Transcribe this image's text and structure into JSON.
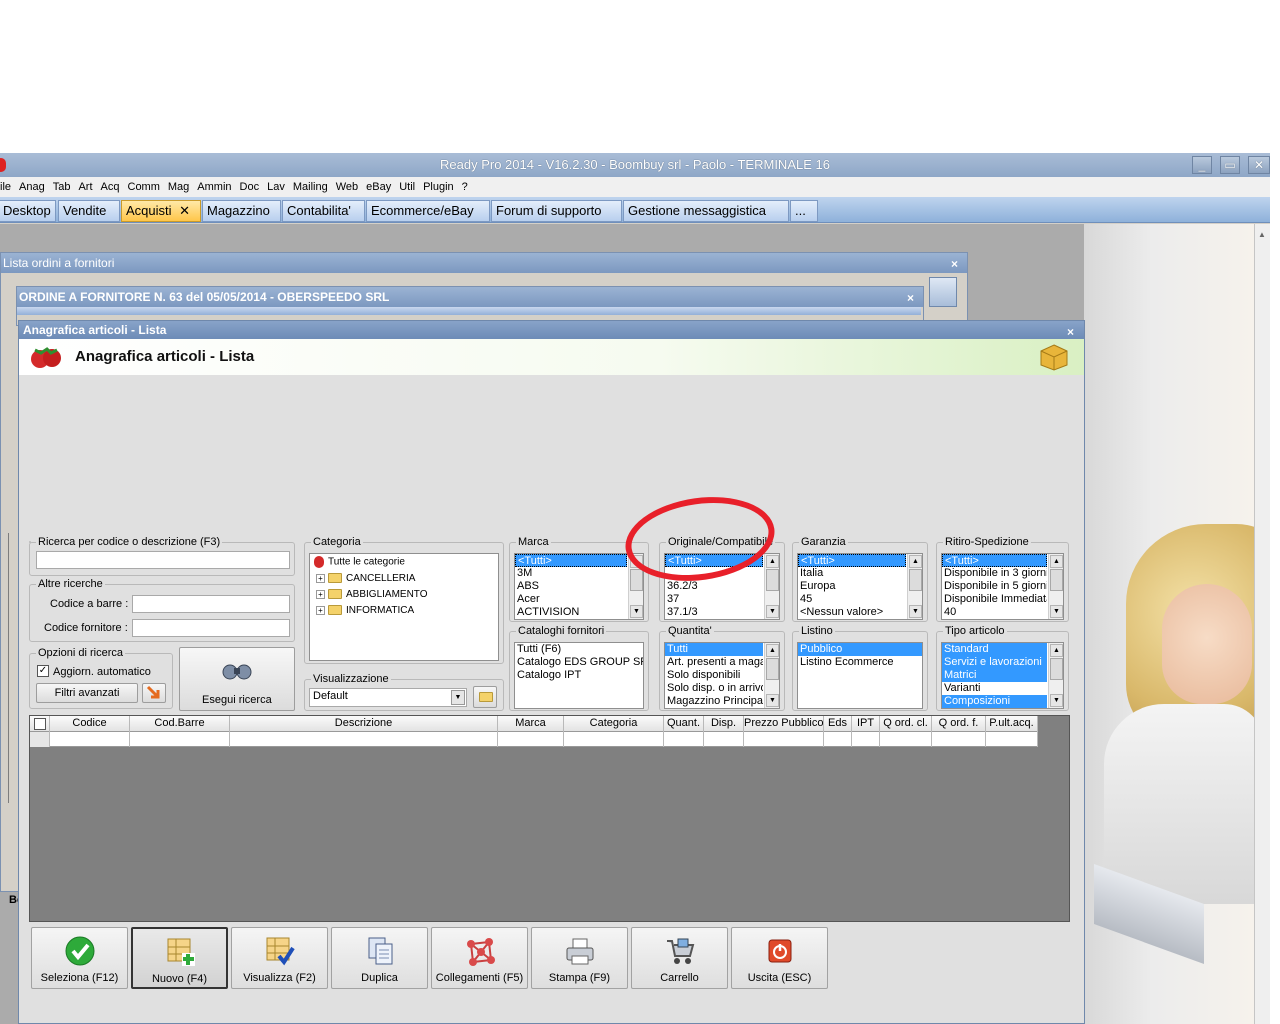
{
  "window": {
    "title": "Ready Pro 2014 - V16.2.30 - Boombuy srl - Paolo - TERMINALE 16",
    "min": "_",
    "max": "▭",
    "close": "✕"
  },
  "menu": [
    "ile",
    "Anag",
    "Tab",
    "Art",
    "Acq",
    "Comm",
    "Mag",
    "Ammin",
    "Doc",
    "Lav",
    "Mailing",
    "Web",
    "eBay",
    "Util",
    "Plugin",
    "?"
  ],
  "tabs": [
    {
      "label": "Desktop",
      "active": false
    },
    {
      "label": "Vendite",
      "active": false
    },
    {
      "label": "Acquisti",
      "active": true,
      "close": "✕"
    },
    {
      "label": "Magazzino",
      "active": false
    },
    {
      "label": "Contabilita'",
      "active": false
    },
    {
      "label": "Ecommerce/eBay",
      "active": false
    },
    {
      "label": "Forum di supporto",
      "active": false
    },
    {
      "label": "Gestione messaggistica",
      "active": false
    },
    {
      "label": "...",
      "active": false
    }
  ],
  "bg_windows": {
    "lista_ordini": "Lista ordini a fornitori",
    "ordine": "ORDINE A FORNITORE N. 63 del 05/05/2014 - OBERSPEEDO SRL",
    "close": "×"
  },
  "main_window": {
    "title": "Anagrafica articoli  - Lista",
    "header_title": "Anagrafica articoli  - Lista",
    "close": "×"
  },
  "search": {
    "group_label": "Ricerca per codice o descrizione (F3)",
    "value": "",
    "altre_label": "Altre ricerche",
    "barcode_label": "Codice a barre :",
    "barcode_value": "",
    "supplier_label": "Codice fornitore :",
    "supplier_value": "",
    "options_label": "Opzioni di ricerca",
    "auto_update_label": "Aggiorn. automatico",
    "auto_update_checked": true,
    "advanced_filters": "Filtri avanzati",
    "run_search": "Esegui ricerca"
  },
  "categoria": {
    "label": "Categoria",
    "root": "Tutte le categorie",
    "items": [
      "CANCELLERIA",
      "ABBIGLIAMENTO",
      "INFORMATICA"
    ]
  },
  "visualizzazione": {
    "label": "Visualizzazione",
    "value": "Default"
  },
  "lists": {
    "marca": {
      "label": "Marca",
      "items": [
        "<Tutti>",
        "3M",
        "ABS",
        "Acer",
        "ACTIVISION"
      ],
      "selected": [
        0
      ]
    },
    "originale": {
      "label": "Originale/Compatibile",
      "items": [
        "<Tutti>",
        "",
        "36.2/3",
        "37",
        "37.1/3"
      ],
      "selected": [
        0
      ]
    },
    "garanzia": {
      "label": "Garanzia",
      "items": [
        "<Tutti>",
        "Italia",
        "Europa",
        "45",
        "<Nessun valore>"
      ],
      "selected": [
        0
      ]
    },
    "ritiro": {
      "label": "Ritiro-Spedizione",
      "items": [
        "<Tutti>",
        "Disponibile in 3 giorni",
        "Disponibile in 5 giorni",
        "Disponibile Immediata",
        "40"
      ],
      "selected": [
        0
      ]
    },
    "cataloghi": {
      "label": "Cataloghi fornitori",
      "items": [
        "Tutti (F6)",
        "Catalogo EDS GROUP SRL",
        "Catalogo IPT"
      ],
      "selected": []
    },
    "quantita": {
      "label": "Quantita'",
      "items": [
        "Tutti",
        "Art. presenti a magazzino",
        "Solo disponibili",
        "Solo disp. o in arrivo",
        "Magazzino Principale"
      ],
      "selected": [
        0
      ]
    },
    "listino": {
      "label": "Listino",
      "items": [
        "Pubblico",
        "Listino Ecommerce"
      ],
      "selected": [
        0
      ]
    },
    "tipo": {
      "label": "Tipo articolo",
      "items": [
        "Standard",
        "Servizi e lavorazioni",
        "Matrici",
        "Varianti",
        "Composizioni"
      ],
      "selected": [
        0,
        1,
        2,
        4
      ]
    }
  },
  "grid": {
    "columns": [
      "",
      "Codice",
      "Cod.Barre",
      "Descrizione",
      "Marca",
      "Categoria",
      "Quant.",
      "Disp.",
      "Prezzo Pubblico",
      "Eds",
      "IPT",
      "Q ord. cl.",
      "Q ord. f.",
      "P.ult.acq."
    ]
  },
  "toolbar": [
    {
      "label": "Seleziona (F12)",
      "icon": "check-icon"
    },
    {
      "label": "Nuovo (F4)",
      "icon": "new-icon",
      "pressed": true
    },
    {
      "label": "Visualizza (F2)",
      "icon": "view-icon"
    },
    {
      "label": "Duplica",
      "icon": "duplicate-icon"
    },
    {
      "label": "Collegamenti (F5)",
      "icon": "links-icon"
    },
    {
      "label": "Stampa (F9)",
      "icon": "print-icon"
    },
    {
      "label": "Carrello",
      "icon": "cart-icon"
    },
    {
      "label": "Uscita (ESC)",
      "icon": "exit-icon"
    }
  ],
  "left_fragment": "Be",
  "colors": {
    "accent_red": "#e8202a",
    "selection": "#3399ff",
    "active_tab": "#ffc64a"
  }
}
